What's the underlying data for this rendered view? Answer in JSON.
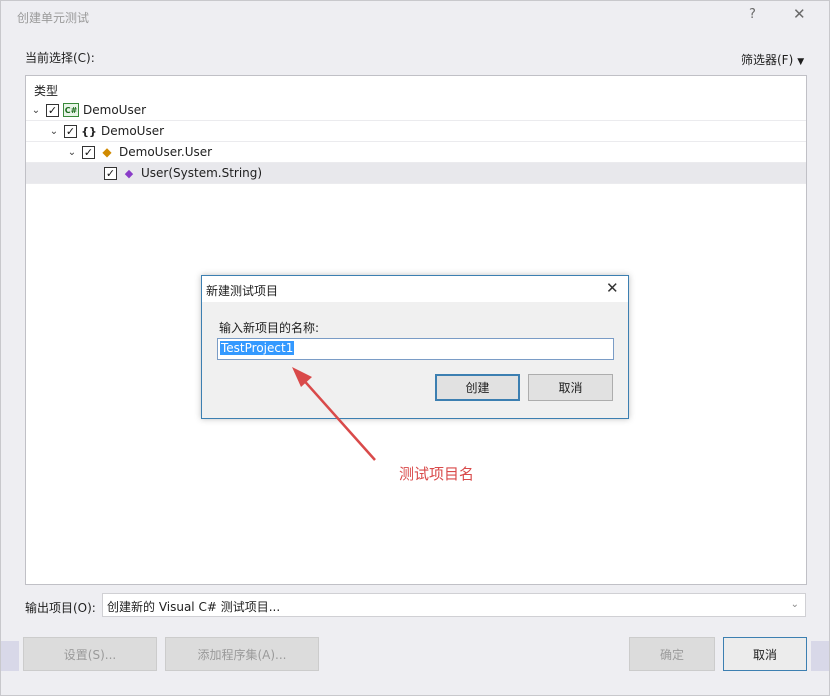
{
  "window": {
    "title": "创建单元测试",
    "help_glyph": "?",
    "close_glyph": "✕"
  },
  "current_selection_label": "当前选择(C):",
  "filter_label": "筛选器(F)",
  "tree": {
    "header": "类型",
    "rows": [
      {
        "label": "DemoUser",
        "icon": "csharp-project-icon",
        "checked": true,
        "expanded": true
      },
      {
        "label": "DemoUser",
        "icon": "namespace-icon",
        "checked": true,
        "expanded": true
      },
      {
        "label": "DemoUser.User",
        "icon": "class-icon",
        "checked": true,
        "expanded": true
      },
      {
        "label": "User(System.String)",
        "icon": "method-icon",
        "checked": true,
        "expanded": false
      }
    ]
  },
  "output": {
    "label": "输出项目(O):",
    "value": "创建新的 Visual C# 测试项目..."
  },
  "buttons": {
    "settings": "设置(S)...",
    "add_assembly": "添加程序集(A)...",
    "ok": "确定",
    "cancel": "取消"
  },
  "sub_dialog": {
    "title": "新建测试项目",
    "close_glyph": "✕",
    "label": "输入新项目的名称:",
    "input_value": "TestProject1",
    "create": "创建",
    "cancel": "取消"
  },
  "annotation": {
    "text": "测试项目名",
    "color": "#d94a4a"
  },
  "colors": {
    "accent": "#3c7fb1",
    "selection": "#3399ff"
  }
}
